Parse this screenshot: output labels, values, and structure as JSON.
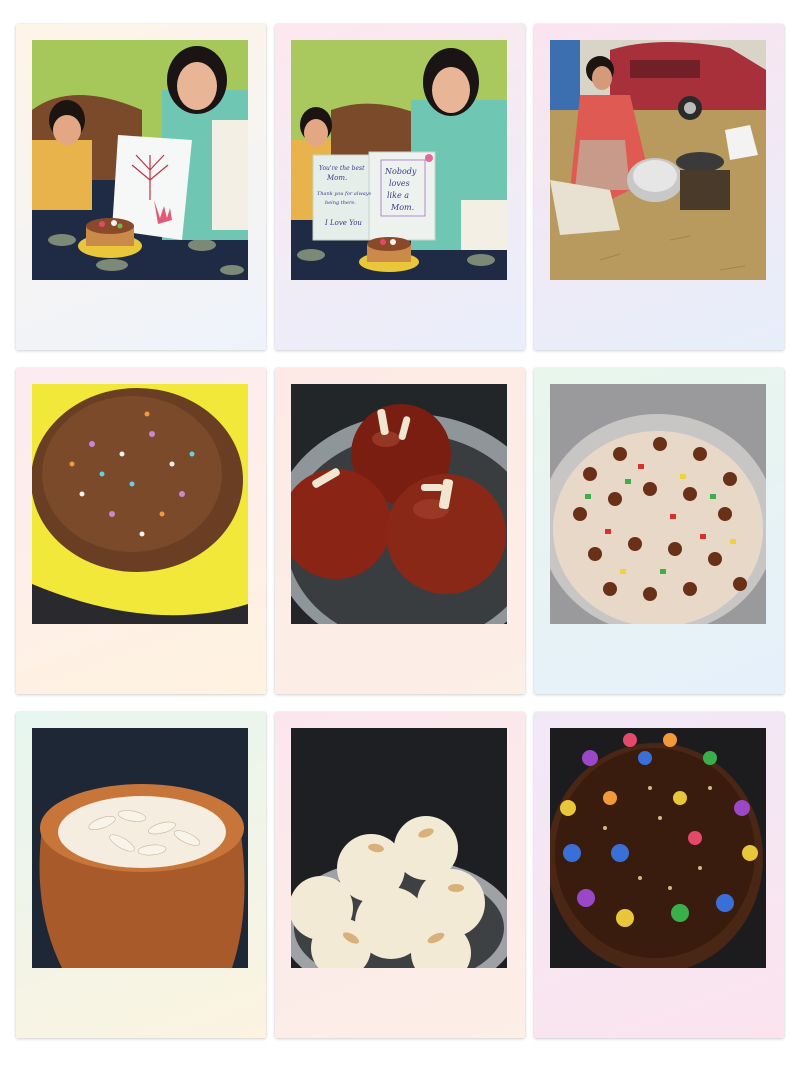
{
  "collage": {
    "layout": "3x3 polaroid grid",
    "tile_colors": {
      "pastel_pink": "#fbe6ee",
      "pastel_blue": "#e6eefb",
      "pastel_yellow": "#fcf3e0",
      "pastel_green": "#e8f6ec",
      "pastel_lilac": "#f1e8f7"
    },
    "photos": [
      {
        "subject": "woman and boy holding handprint card with cake"
      },
      {
        "subject": "woman and boy holding greeting card with cake"
      },
      {
        "subject": "woman cooking outdoors by car"
      },
      {
        "subject": "vermicelli dessert with sprinkles"
      },
      {
        "subject": "gulab jamun with almond slivers"
      },
      {
        "subject": "fruit cake batter with chocolate balls"
      },
      {
        "subject": "rabri in clay pot with almonds"
      },
      {
        "subject": "coconut ladoo with almonds"
      },
      {
        "subject": "chocolate cake with gems candies"
      }
    ]
  },
  "greeting_card": {
    "left_text": [
      "You're the best",
      "Mom.",
      "Thank you for always",
      "being there.",
      "I Love You"
    ],
    "right_text": [
      "Nobody",
      "loves",
      "like a",
      "Mom."
    ]
  }
}
